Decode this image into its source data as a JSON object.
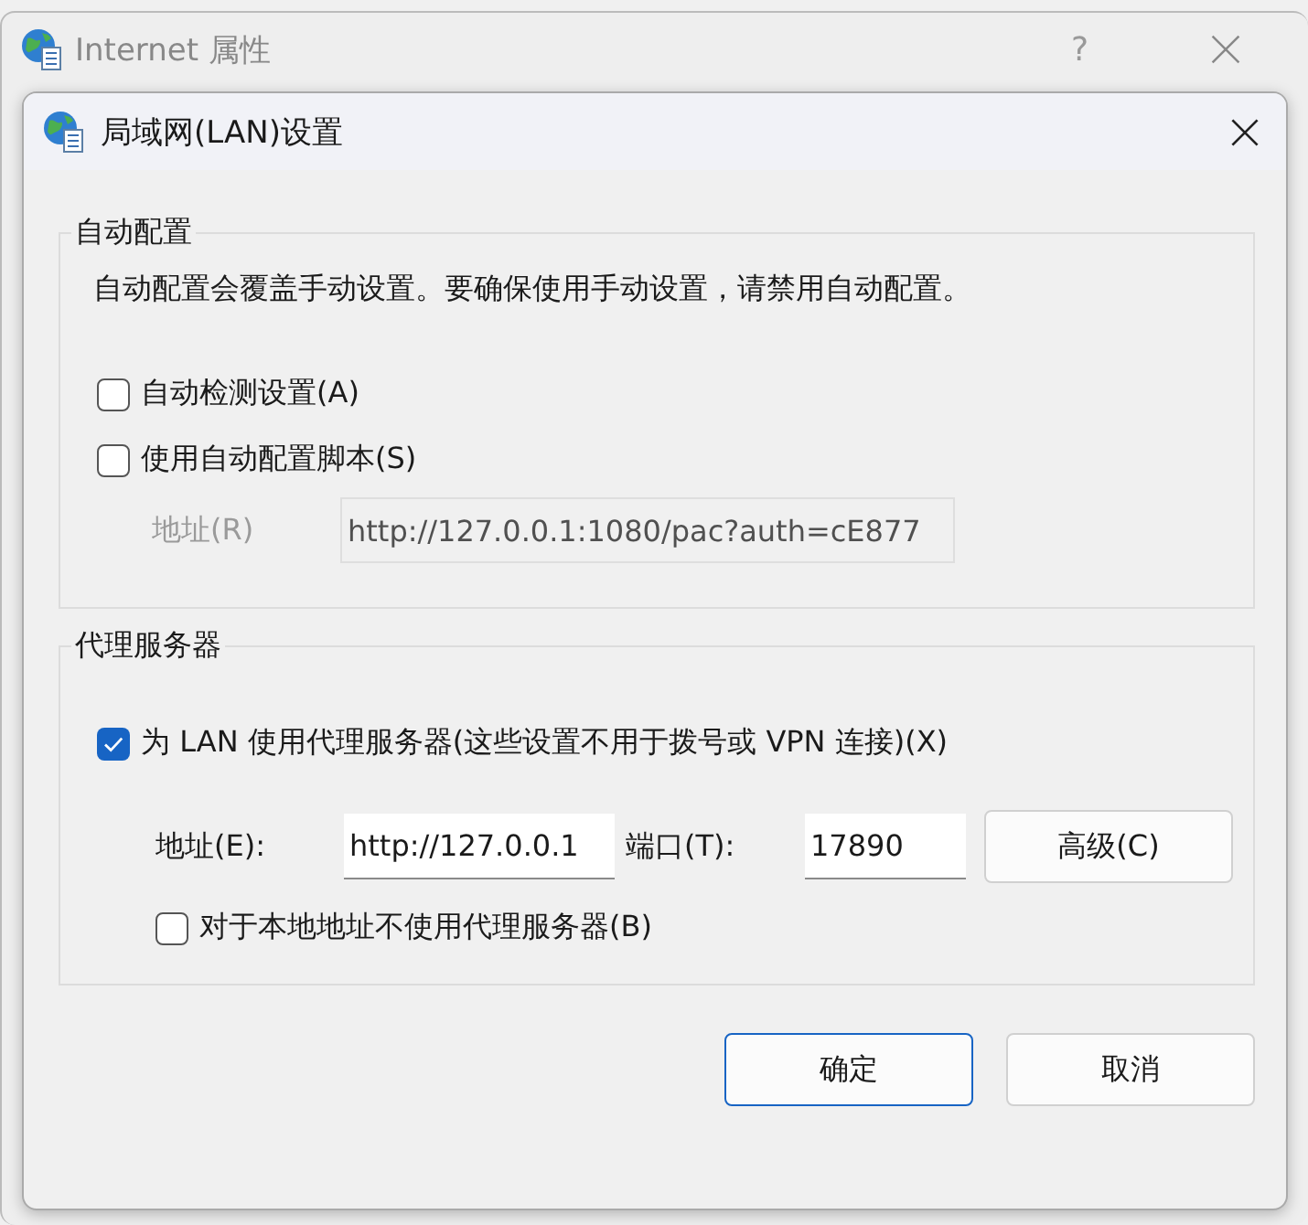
{
  "parent_window": {
    "title": "Internet 属性",
    "help_button": "?"
  },
  "dialog": {
    "title": "局域网(LAN)设置"
  },
  "auto_config": {
    "title": "自动配置",
    "description": "自动配置会覆盖手动设置。要确保使用手动设置，请禁用自动配置。",
    "checkboxes": [
      {
        "label": "自动检测设置(A)",
        "checked": false
      },
      {
        "label": "使用自动配置脚本(S)",
        "checked": false
      }
    ],
    "script_address": {
      "label": "地址(R)",
      "value": "http://127.0.0.1:1080/pac?auth=cE877",
      "disabled": true
    }
  },
  "proxy": {
    "title": "代理服务器",
    "use_proxy": {
      "label": "为 LAN 使用代理服务器(这些设置不用于拨号或 VPN 连接)(X)",
      "checked": true
    },
    "address": {
      "label": "地址(E):",
      "value": "http://127.0.0.1"
    },
    "port": {
      "label": "端口(T):",
      "value": "17890"
    },
    "advanced_button": "高级(C)",
    "bypass_local": {
      "label": "对于本地地址不使用代理服务器(B)",
      "checked": false
    }
  },
  "buttons": [
    {
      "label": "确定",
      "kind": "primary"
    },
    {
      "label": "取消",
      "kind": "default"
    }
  ]
}
